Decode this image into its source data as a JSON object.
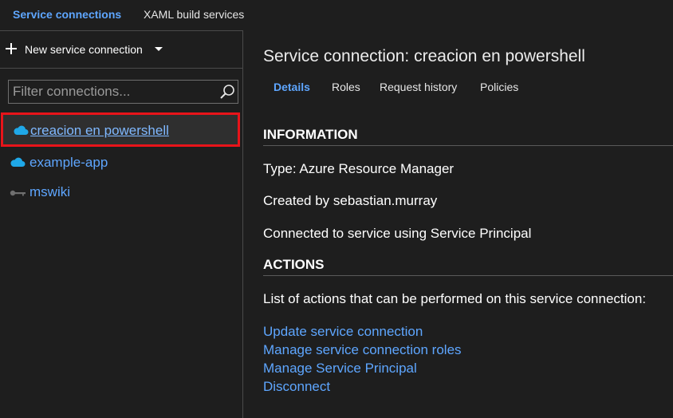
{
  "top_tabs": {
    "service_connections": "Service connections",
    "xaml_build_services": "XAML build services"
  },
  "sidebar": {
    "new_connection_label": "New service connection",
    "filter_placeholder": "Filter connections...",
    "connections": [
      {
        "label": "creacion en powershell",
        "icon": "cloud-icon",
        "selected": true
      },
      {
        "label": "example-app",
        "icon": "cloud-icon",
        "selected": false
      },
      {
        "label": "mswiki",
        "icon": "key-icon",
        "selected": false
      }
    ]
  },
  "main": {
    "title": "Service connection: creacion en powershell",
    "tabs": [
      "Details",
      "Roles",
      "Request history",
      "Policies"
    ],
    "information_heading": "INFORMATION",
    "type_line": "Type: Azure Resource Manager",
    "created_by_line": "Created by sebastian.murray",
    "connected_line": "Connected to service using Service Principal",
    "actions_heading": "ACTIONS",
    "actions_intro": "List of actions that can be performed on this service connection:",
    "actions": [
      "Update service connection",
      "Manage service connection roles",
      "Manage Service Principal",
      "Disconnect"
    ]
  },
  "colors": {
    "accent": "#5ea6ff",
    "background": "#1e1e1e",
    "selection_border": "#e8141a",
    "cloud": "#1fa8e8"
  }
}
